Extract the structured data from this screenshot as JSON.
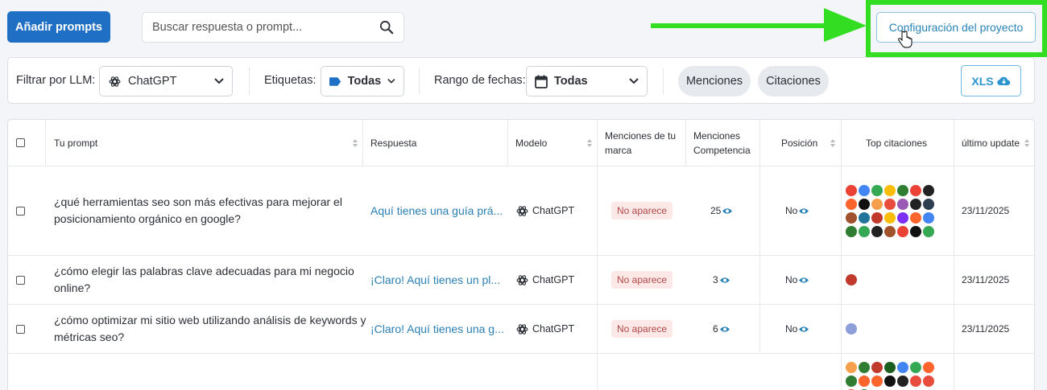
{
  "toolbar": {
    "add_label": "Añadir prompts",
    "search_placeholder": "Buscar respuesta o prompt...",
    "config_label": "Configuración del proyecto"
  },
  "filters": {
    "llm_label": "Filtrar por LLM:",
    "llm_value": "ChatGPT",
    "tags_label": "Etiquetas:",
    "tags_value": "Todas",
    "dates_label": "Rango de fechas:",
    "dates_value": "Todas",
    "mentions_label": "Menciones",
    "citations_label": "Citaciones",
    "xls_label": "XLS"
  },
  "table": {
    "headers": {
      "prompt": "Tu prompt",
      "response": "Respuesta",
      "model": "Modelo",
      "brand_mentions_1": "Menciones de tu",
      "brand_mentions_2": "marca",
      "comp_mentions_1": "Menciones",
      "comp_mentions_2": "Competencia",
      "position": "Posición",
      "top_citations": "Top citaciones",
      "last_update": "último update"
    },
    "rows": [
      {
        "prompt_1": "¿qué herramientas seo son más efectivas para mejorar el",
        "prompt_2": "posicionamiento orgánico en google?",
        "response": "Aquí tienes una guía prá...",
        "model": "ChatGPT",
        "brand": "No aparece",
        "competition": "25",
        "position": "No",
        "date": "23/11/2025"
      },
      {
        "prompt_1": "¿cómo elegir las palabras clave adecuadas para mi negocio",
        "prompt_2": "online?",
        "response": "¡Claro! Aquí tienes un pl...",
        "model": "ChatGPT",
        "brand": "No aparece",
        "competition": "3",
        "position": "No",
        "date": "23/11/2025"
      },
      {
        "prompt_1": "¿cómo optimizar mi sitio web utilizando análisis de keywords y",
        "prompt_2": "métricas seo?",
        "response": "¡Claro! Aquí tienes una g...",
        "model": "ChatGPT",
        "brand": "No aparece",
        "competition": "6",
        "position": "No",
        "date": "23/11/2025"
      }
    ]
  },
  "colors": {
    "primary": "#1f6fc5",
    "highlight": "#33dd22",
    "link": "#2a7fb3",
    "badge_bg": "#fde8e8"
  }
}
